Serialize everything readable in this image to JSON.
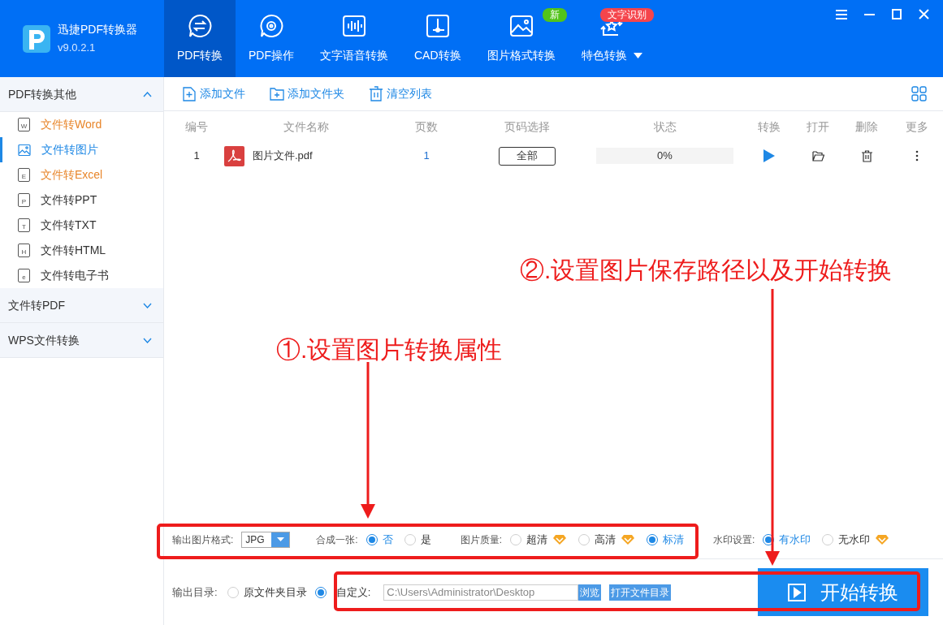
{
  "app": {
    "name": "迅捷PDF转换器",
    "version": "v9.0.2.1"
  },
  "nav": [
    {
      "label": "PDF转换",
      "selected": true,
      "dropdown": false
    },
    {
      "label": "PDF操作",
      "selected": false,
      "dropdown": false
    },
    {
      "label": "文字语音转换",
      "selected": false,
      "dropdown": false
    },
    {
      "label": "CAD转换",
      "selected": false,
      "dropdown": false
    },
    {
      "label": "图片格式转换",
      "selected": false,
      "dropdown": false,
      "badge": {
        "text": "新",
        "color": "#52c41a"
      }
    },
    {
      "label": "特色转换",
      "selected": false,
      "dropdown": true,
      "badge": {
        "text": "文字识别",
        "color": "#f5454c"
      }
    }
  ],
  "sidebar": [
    {
      "title": "PDF转换其他",
      "expanded": true,
      "items": [
        {
          "label": "文件转Word",
          "icon": "W",
          "selected": false,
          "color": "#e8862b"
        },
        {
          "label": "文件转图片",
          "selected": true,
          "color": "#1e88e5"
        },
        {
          "label": "文件转Excel",
          "icon": "E",
          "selected": false,
          "color": "#e8862b"
        },
        {
          "label": "文件转PPT",
          "icon": "P",
          "selected": false,
          "color": "#333333"
        },
        {
          "label": "文件转TXT",
          "icon": "T",
          "selected": false,
          "color": "#333333"
        },
        {
          "label": "文件转HTML",
          "icon": "H",
          "selected": false,
          "color": "#333333"
        },
        {
          "label": "文件转电子书",
          "icon": "e",
          "selected": false,
          "color": "#333333"
        }
      ]
    },
    {
      "title": "文件转PDF",
      "expanded": false
    },
    {
      "title": "WPS文件转换",
      "expanded": false
    }
  ],
  "toolbar": [
    "添加文件",
    "添加文件夹",
    "清空列表"
  ],
  "table": {
    "columns": [
      "编号",
      "文件名称",
      "页数",
      "页码选择",
      "状态",
      "转换",
      "打开",
      "删除",
      "更多"
    ],
    "rows": [
      {
        "number": "1",
        "name": "图片文件.pdf",
        "pages": "1",
        "page_select": "全部",
        "status": "0%",
        "level": 0
      }
    ]
  },
  "settings": [
    {
      "kind": "select",
      "label": "输出图片格式:",
      "value": "JPG"
    },
    {
      "kind": "radio",
      "label": "合成一张:",
      "options": [
        {
          "label": "否",
          "selected": true,
          "premium": false
        },
        {
          "label": "是",
          "selected": false,
          "premium": false
        }
      ]
    },
    {
      "kind": "radio",
      "label": "图片质量:",
      "options": [
        {
          "label": "超清",
          "selected": false,
          "premium": true
        },
        {
          "label": "高清",
          "selected": false,
          "premium": true
        },
        {
          "label": "标清",
          "selected": true,
          "premium": false
        }
      ]
    },
    {
      "kind": "radio",
      "label": "水印设置:",
      "options": [
        {
          "label": "有水印",
          "selected": true,
          "premium": false
        },
        {
          "label": "无水印",
          "selected": false,
          "premium": true
        }
      ]
    }
  ],
  "output": {
    "label": "输出目录:",
    "options": [
      {
        "label": "原文件夹目录",
        "selected": false
      },
      {
        "label": "自定义:",
        "selected": true
      }
    ],
    "path": "C:\\Users\\Administrator\\Desktop",
    "browse": "浏览",
    "open_dir": "打开文件目录",
    "start": "开始转换"
  },
  "annotations": [
    "②.设置图片保存路径以及开始转换",
    "①.设置图片转换属性"
  ]
}
